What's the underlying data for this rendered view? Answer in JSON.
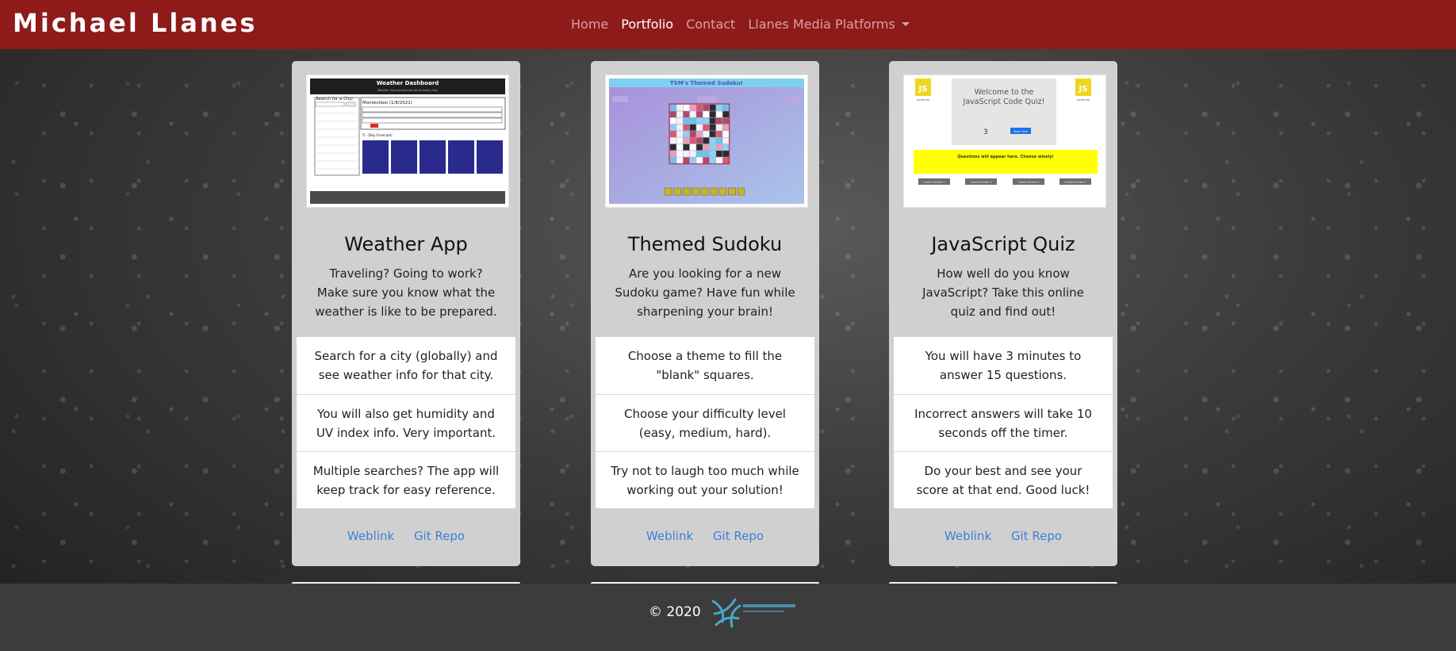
{
  "navbar": {
    "brand": "Michael Llanes",
    "links": [
      {
        "label": "Home",
        "active": false
      },
      {
        "label": "Portfolio",
        "active": true
      },
      {
        "label": "Contact",
        "active": false
      },
      {
        "label": "Llanes Media Platforms",
        "active": false,
        "dropdown": true
      }
    ],
    "background_color": "#8f1a1a"
  },
  "cards": [
    {
      "title": "Weather App",
      "text": "Traveling? Going to work? Make sure you know what the weather is like to be prepared.",
      "thumbnail": {
        "header": "Weather Dashboard",
        "subheader": "Weather from around the world (every city)",
        "search_label": "Search for a City:",
        "city_line": "Montevideo (1/8/2021)",
        "forecast_label": "5 - Day Forecast:"
      },
      "items": [
        "Search for a city (globally) and see weather info for that city.",
        "You will also get humidity and UV index info. Very important.",
        "Multiple searches? The app will keep track for easy reference."
      ],
      "links": {
        "weblink": "Weblink",
        "repo": "Git Repo"
      }
    },
    {
      "title": "Themed Sudoku",
      "text": "Are you looking for a new Sudoku game? Have fun while sharpening your brain!",
      "thumbnail": {
        "header": "TSM's Themed Sudoku!"
      },
      "items": [
        "Choose a theme to fill the \"blank\" squares.",
        "Choose your difficulty level (easy, medium, hard).",
        "Try not to laugh too much while working out your solution!"
      ],
      "links": {
        "weblink": "Weblink",
        "repo": "Git Repo"
      }
    },
    {
      "title": "JavaScript Quiz",
      "text": "How well do you know JavaScript? Take this online quiz and find out!",
      "thumbnail": {
        "welcome": "Welcome to the JavaScript Code Quiz!",
        "timer": "3",
        "start_button": "Start Quiz",
        "banner": "Questions will appear here. Choose wisely!",
        "answers": [
          "Answer Number 1",
          "Answer Number 2",
          "Answer Number 3",
          "Answer Number 4"
        ],
        "js_logo": "JS",
        "js_caption": "JavaScript"
      },
      "items": [
        "You will have 3 minutes to answer 15 questions.",
        "Incorrect answers will take 10 seconds off the timer.",
        "Do your best and see your score at that end. Good luck!"
      ],
      "links": {
        "weblink": "Weblink",
        "repo": "Git Repo"
      }
    }
  ],
  "footer": {
    "copyright": "© 2020",
    "logo_icon": "small-badger-logo-icon"
  }
}
